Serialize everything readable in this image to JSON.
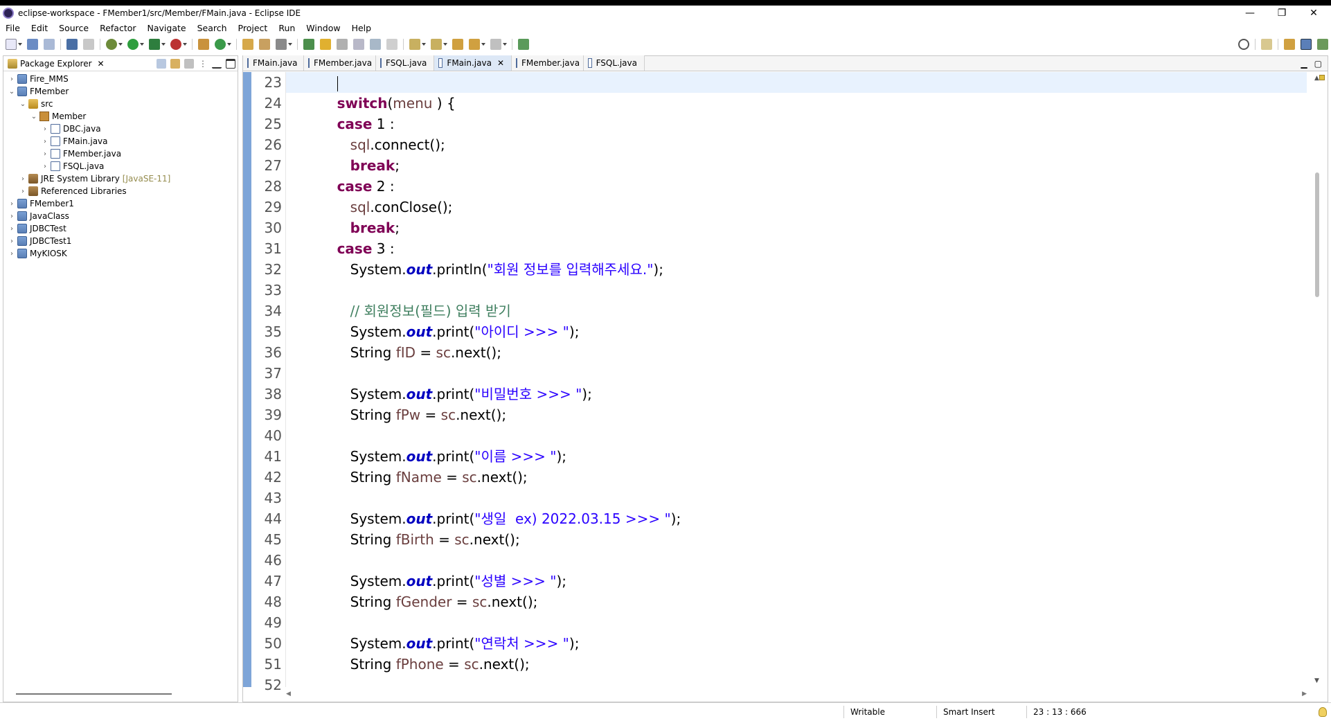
{
  "window": {
    "title": "eclipse-workspace - FMember1/src/Member/FMain.java - Eclipse IDE",
    "minimize": "—",
    "restore": "❐",
    "close": "✕"
  },
  "menu": [
    "File",
    "Edit",
    "Source",
    "Refactor",
    "Navigate",
    "Search",
    "Project",
    "Run",
    "Window",
    "Help"
  ],
  "package_explorer": {
    "tab_label": "Package Explorer",
    "tree": [
      {
        "label": "Fire_MMS",
        "indent": 0,
        "twisty": "›",
        "icon": "project"
      },
      {
        "label": "FMember",
        "indent": 0,
        "twisty": "⌄",
        "icon": "project"
      },
      {
        "label": "src",
        "indent": 1,
        "twisty": "⌄",
        "icon": "src"
      },
      {
        "label": "Member",
        "indent": 2,
        "twisty": "⌄",
        "icon": "package"
      },
      {
        "label": "DBC.java",
        "indent": 3,
        "twisty": "›",
        "icon": "java"
      },
      {
        "label": "FMain.java",
        "indent": 3,
        "twisty": "›",
        "icon": "java"
      },
      {
        "label": "FMember.java",
        "indent": 3,
        "twisty": "›",
        "icon": "java"
      },
      {
        "label": "FSQL.java",
        "indent": 3,
        "twisty": "›",
        "icon": "java"
      },
      {
        "label": "JRE System Library",
        "suffix": "[JavaSE-11]",
        "indent": 1,
        "twisty": "›",
        "icon": "library"
      },
      {
        "label": "Referenced Libraries",
        "indent": 1,
        "twisty": "›",
        "icon": "library"
      },
      {
        "label": "FMember1",
        "indent": 0,
        "twisty": "›",
        "icon": "project"
      },
      {
        "label": "JavaClass",
        "indent": 0,
        "twisty": "›",
        "icon": "project"
      },
      {
        "label": "JDBCTest",
        "indent": 0,
        "twisty": "›",
        "icon": "project"
      },
      {
        "label": "JDBCTest1",
        "indent": 0,
        "twisty": "›",
        "icon": "project"
      },
      {
        "label": "MyKIOSK",
        "indent": 0,
        "twisty": "›",
        "icon": "project"
      }
    ]
  },
  "editor": {
    "tabs": [
      {
        "label": "FMain.java",
        "active": false
      },
      {
        "label": "FMember.java",
        "active": false
      },
      {
        "label": "FSQL.java",
        "active": false
      },
      {
        "label": "FMain.java",
        "active": true
      },
      {
        "label": "FMember.java",
        "active": false
      },
      {
        "label": "FSQL.java",
        "active": false
      }
    ],
    "lines": [
      {
        "n": "23",
        "cur": true,
        "toks": [
          [
            "",
            "          "
          ]
        ]
      },
      {
        "n": "24",
        "toks": [
          [
            "",
            "          "
          ],
          [
            "kw",
            "switch"
          ],
          [
            "",
            "("
          ],
          [
            "var",
            "menu"
          ],
          [
            "",
            " ) {"
          ]
        ]
      },
      {
        "n": "25",
        "toks": [
          [
            "",
            "          "
          ],
          [
            "kw",
            "case"
          ],
          [
            "",
            " 1 :"
          ]
        ]
      },
      {
        "n": "26",
        "toks": [
          [
            "",
            "             "
          ],
          [
            "var",
            "sql"
          ],
          [
            "",
            ".connect();"
          ]
        ]
      },
      {
        "n": "27",
        "toks": [
          [
            "",
            "             "
          ],
          [
            "kw",
            "break"
          ],
          [
            "",
            ";"
          ]
        ]
      },
      {
        "n": "28",
        "toks": [
          [
            "",
            "          "
          ],
          [
            "kw",
            "case"
          ],
          [
            "",
            " 2 :"
          ]
        ]
      },
      {
        "n": "29",
        "toks": [
          [
            "",
            "             "
          ],
          [
            "var",
            "sql"
          ],
          [
            "",
            ".conClose();"
          ]
        ]
      },
      {
        "n": "30",
        "toks": [
          [
            "",
            "             "
          ],
          [
            "kw",
            "break"
          ],
          [
            "",
            ";"
          ]
        ]
      },
      {
        "n": "31",
        "toks": [
          [
            "",
            "          "
          ],
          [
            "kw",
            "case"
          ],
          [
            "",
            " 3 :"
          ]
        ]
      },
      {
        "n": "32",
        "toks": [
          [
            "",
            "             System."
          ],
          [
            "fld",
            "out"
          ],
          [
            "",
            ".println("
          ],
          [
            "str",
            "\"회원 정보를 입력해주세요.\""
          ],
          [
            "",
            ");"
          ]
        ]
      },
      {
        "n": "33",
        "toks": [
          [
            "",
            ""
          ]
        ]
      },
      {
        "n": "34",
        "toks": [
          [
            "",
            "             "
          ],
          [
            "cmt",
            "// 회원정보(필드) 입력 받기"
          ]
        ]
      },
      {
        "n": "35",
        "toks": [
          [
            "",
            "             System."
          ],
          [
            "fld",
            "out"
          ],
          [
            "",
            ".print("
          ],
          [
            "str",
            "\"아이디 >>> \""
          ],
          [
            "",
            ");"
          ]
        ]
      },
      {
        "n": "36",
        "toks": [
          [
            "",
            "             String "
          ],
          [
            "var",
            "fID"
          ],
          [
            "",
            " = "
          ],
          [
            "var",
            "sc"
          ],
          [
            "",
            ".next();"
          ]
        ]
      },
      {
        "n": "37",
        "toks": [
          [
            "",
            ""
          ]
        ]
      },
      {
        "n": "38",
        "toks": [
          [
            "",
            "             System."
          ],
          [
            "fld",
            "out"
          ],
          [
            "",
            ".print("
          ],
          [
            "str",
            "\"비밀번호 >>> \""
          ],
          [
            "",
            ");"
          ]
        ]
      },
      {
        "n": "39",
        "toks": [
          [
            "",
            "             String "
          ],
          [
            "var",
            "fPw"
          ],
          [
            "",
            " = "
          ],
          [
            "var",
            "sc"
          ],
          [
            "",
            ".next();"
          ]
        ]
      },
      {
        "n": "40",
        "toks": [
          [
            "",
            ""
          ]
        ]
      },
      {
        "n": "41",
        "toks": [
          [
            "",
            "             System."
          ],
          [
            "fld",
            "out"
          ],
          [
            "",
            ".print("
          ],
          [
            "str",
            "\"이름 >>> \""
          ],
          [
            "",
            ");"
          ]
        ]
      },
      {
        "n": "42",
        "toks": [
          [
            "",
            "             String "
          ],
          [
            "var",
            "fName"
          ],
          [
            "",
            " = "
          ],
          [
            "var",
            "sc"
          ],
          [
            "",
            ".next();"
          ]
        ]
      },
      {
        "n": "43",
        "toks": [
          [
            "",
            ""
          ]
        ]
      },
      {
        "n": "44",
        "toks": [
          [
            "",
            "             System."
          ],
          [
            "fld",
            "out"
          ],
          [
            "",
            ".print("
          ],
          [
            "str",
            "\"생일  ex) 2022.03.15 >>> \""
          ],
          [
            "",
            ");"
          ]
        ]
      },
      {
        "n": "45",
        "toks": [
          [
            "",
            "             String "
          ],
          [
            "var",
            "fBirth"
          ],
          [
            "",
            " = "
          ],
          [
            "var",
            "sc"
          ],
          [
            "",
            ".next();"
          ]
        ]
      },
      {
        "n": "46",
        "toks": [
          [
            "",
            ""
          ]
        ]
      },
      {
        "n": "47",
        "toks": [
          [
            "",
            "             System."
          ],
          [
            "fld",
            "out"
          ],
          [
            "",
            ".print("
          ],
          [
            "str",
            "\"성별 >>> \""
          ],
          [
            "",
            ");"
          ]
        ]
      },
      {
        "n": "48",
        "toks": [
          [
            "",
            "             String "
          ],
          [
            "var",
            "fGender"
          ],
          [
            "",
            " = "
          ],
          [
            "var",
            "sc"
          ],
          [
            "",
            ".next();"
          ]
        ]
      },
      {
        "n": "49",
        "toks": [
          [
            "",
            ""
          ]
        ]
      },
      {
        "n": "50",
        "toks": [
          [
            "",
            "             System."
          ],
          [
            "fld",
            "out"
          ],
          [
            "",
            ".print("
          ],
          [
            "str",
            "\"연락처 >>> \""
          ],
          [
            "",
            ");"
          ]
        ]
      },
      {
        "n": "51",
        "toks": [
          [
            "",
            "             String "
          ],
          [
            "var",
            "fPhone"
          ],
          [
            "",
            " = "
          ],
          [
            "var",
            "sc"
          ],
          [
            "",
            ".next();"
          ]
        ]
      },
      {
        "n": "52",
        "toks": [
          [
            "",
            ""
          ]
        ]
      }
    ]
  },
  "status": {
    "writable": "Writable",
    "insert_mode": "Smart Insert",
    "position": "23 : 13 : 666"
  }
}
